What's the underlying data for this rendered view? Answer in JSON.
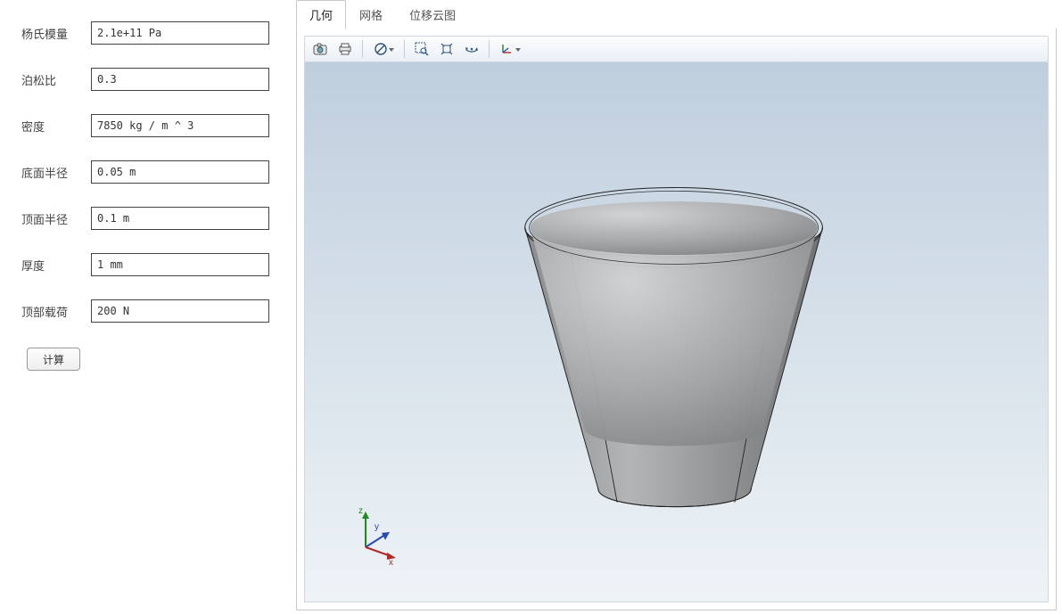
{
  "form": {
    "fields": [
      {
        "label": "杨氏模量",
        "value": "2.1e+11 Pa",
        "name": "youngs-modulus-field"
      },
      {
        "label": "泊松比",
        "value": "0.3",
        "name": "poisson-ratio-field"
      },
      {
        "label": "密度",
        "value": "7850 kg / m ^ 3",
        "name": "density-field"
      },
      {
        "label": "底面半径",
        "value": "0.05 m",
        "name": "bottom-radius-field"
      },
      {
        "label": "顶面半径",
        "value": "0.1 m",
        "name": "top-radius-field"
      },
      {
        "label": "厚度",
        "value": "1 mm",
        "name": "thickness-field"
      },
      {
        "label": "顶部载荷",
        "value": "200 N",
        "name": "top-load-field"
      }
    ],
    "compute_label": "计算"
  },
  "tabs": [
    {
      "label": "几何",
      "name": "tab-geometry",
      "active": true
    },
    {
      "label": "网格",
      "name": "tab-mesh",
      "active": false
    },
    {
      "label": "位移云图",
      "name": "tab-displacement",
      "active": false
    }
  ],
  "toolbar_icons": {
    "camera": "camera-icon",
    "print": "print-icon",
    "transparency": "transparency-icon",
    "zoom_box": "zoom-box-icon",
    "zoom_extents": "zoom-extents-icon",
    "rotate": "rotate-icon",
    "triad": "triad-icon"
  },
  "triad_axes": {
    "x": "x",
    "y": "y",
    "z": "z"
  },
  "colors": {
    "panel_border": "#c8c8c8",
    "toolbar_border": "#cfd6de",
    "canvas_grad_top": "#bfcede",
    "canvas_grad_bot": "#eef3f7",
    "geom_fill_light": "#c6c7c9",
    "geom_fill_dark": "#8c8d8f",
    "geom_edge": "#222"
  }
}
